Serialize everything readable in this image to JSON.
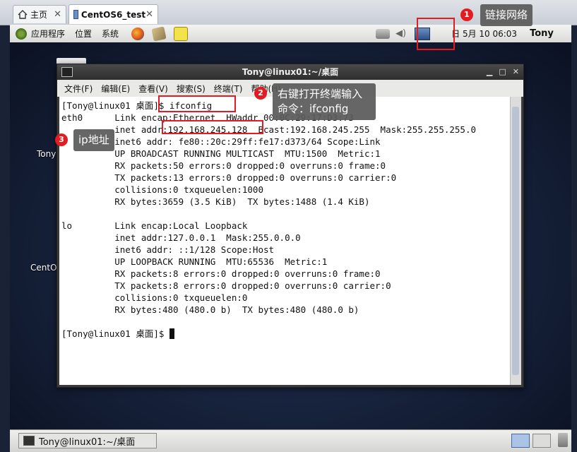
{
  "vm_tabs": [
    {
      "label": "主页",
      "close": "✕"
    },
    {
      "label": "CentOS6_test",
      "close": "✕"
    }
  ],
  "panel": {
    "apps_menu": "应用程序",
    "places_menu": "位置",
    "system_menu": "系统",
    "date": "日 5月 10 06:03",
    "user": "Tony"
  },
  "desktop": {
    "icon1_label": "Tony",
    "icon2_label": "CentO"
  },
  "terminal": {
    "title": "Tony@linux01:~/桌面",
    "menu": [
      "文件(F)",
      "编辑(E)",
      "查看(V)",
      "搜索(S)",
      "终端(T)",
      "帮助(H)"
    ],
    "lines": [
      "[Tony@linux01 桌面]$ ifconfig",
      "eth0      Link encap:Ethernet  HWaddr 00:0C:29:17:D3:73",
      "          inet addr:192.168.245.128  Bcast:192.168.245.255  Mask:255.255.255.0",
      "          inet6 addr: fe80::20c:29ff:fe17:d373/64 Scope:Link",
      "          UP BROADCAST RUNNING MULTICAST  MTU:1500  Metric:1",
      "          RX packets:50 errors:0 dropped:0 overruns:0 frame:0",
      "          TX packets:13 errors:0 dropped:0 overruns:0 carrier:0",
      "          collisions:0 txqueuelen:1000",
      "          RX bytes:3659 (3.5 KiB)  TX bytes:1488 (1.4 KiB)",
      "",
      "lo        Link encap:Local Loopback",
      "          inet addr:127.0.0.1  Mask:255.0.0.0",
      "          inet6 addr: ::1/128 Scope:Host",
      "          UP LOOPBACK RUNNING  MTU:65536  Metric:1",
      "          RX packets:8 errors:0 dropped:0 overruns:0 frame:0",
      "          TX packets:8 errors:0 dropped:0 overruns:0 carrier:0",
      "          collisions:0 txqueuelen:0",
      "          RX bytes:480 (480.0 b)  TX bytes:480 (480.0 b)",
      ""
    ],
    "prompt": "[Tony@linux01 桌面]$ "
  },
  "taskbar": {
    "item_label": "Tony@linux01:~/桌面"
  },
  "annotations": [
    {
      "number": "1",
      "text": "链接网络"
    },
    {
      "number": "2",
      "text": "右键打开终端输入\n命令：ifconfig"
    },
    {
      "number": "3",
      "text": "ip地址"
    }
  ],
  "colors": {
    "annotation_red": "#e31b23",
    "tooltip_bg": "#5a5a5a"
  }
}
